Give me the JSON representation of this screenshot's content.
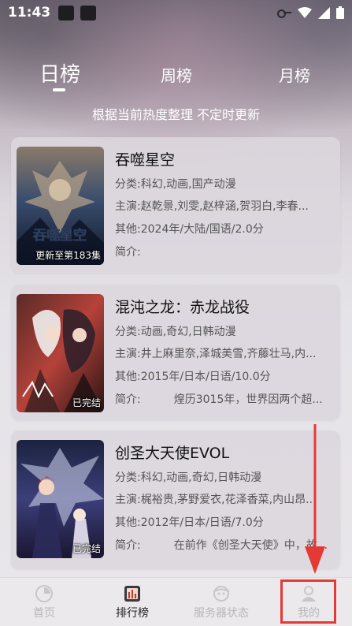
{
  "status_bar": {
    "time": "11:43"
  },
  "tabs": [
    {
      "label": "日榜",
      "active": true
    },
    {
      "label": "周榜",
      "active": false
    },
    {
      "label": "月榜",
      "active": false
    }
  ],
  "subtitle": "根据当前热度整理 不定时更新",
  "items": [
    {
      "title": "吞噬星空",
      "category_label": "分类:",
      "category": "科幻,动画,国产动漫",
      "cast_label": "主演:",
      "cast": "赵乾景,刘雯,赵梓涵,贺羽白,李春...",
      "other_label": "其他:",
      "other": "2024年/大陆/国语/2.0分",
      "synopsis_label": "简介:",
      "synopsis": "",
      "badge": "更新至第183集",
      "cover_art_text": "吞噬星空"
    },
    {
      "title": "混沌之龙：赤龙战役",
      "category_label": "分类:",
      "category": "动画,奇幻,日韩动漫",
      "cast_label": "主演:",
      "cast": "井上麻里奈,泽城美雪,齐藤壮马,内...",
      "other_label": "其他:",
      "other": "2015年/日本/日语/10.0分",
      "synopsis_label": "简介:",
      "synopsis": "煌历3015年，世界因两个超...",
      "badge": "已完结"
    },
    {
      "title": "创圣大天使EVOL",
      "category_label": "分类:",
      "category": "科幻,动画,奇幻,日韩动漫",
      "cast_label": "主演:",
      "cast": "梶裕贵,茅野爱衣,花泽香菜,内山昂...",
      "other_label": "其他:",
      "other": "2012年/日本/日语/7.0分",
      "synopsis_label": "简介:",
      "synopsis": "在前作《创圣大天使》中，故...",
      "badge": "已完结"
    }
  ],
  "bottom_nav": [
    {
      "label": "首页",
      "icon": "home-icon",
      "active": false
    },
    {
      "label": "排行榜",
      "icon": "ranking-icon",
      "active": true
    },
    {
      "label": "服务器状态",
      "icon": "server-status-icon",
      "active": false
    },
    {
      "label": "我的",
      "icon": "profile-icon",
      "active": false
    }
  ],
  "colors": {
    "annotation": "#e53935",
    "accent_tab_text": "#ffffff"
  }
}
